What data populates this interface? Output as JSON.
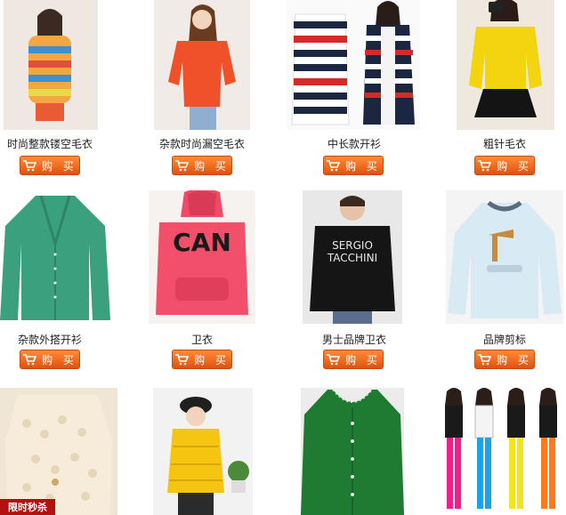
{
  "buy_label": "购 买",
  "products": [
    {
      "title": "时尚整款镂空毛衣",
      "photo": "striped-colorful-sweater"
    },
    {
      "title": "杂款时尚漏空毛衣",
      "photo": "orange-knit-sweater"
    },
    {
      "title": "中长款开衫",
      "photo": "navy-red-striped-cardigan"
    },
    {
      "title": "粗针毛衣",
      "photo": "yellow-cable-knit-sweater"
    },
    {
      "title": "杂款外搭开衫",
      "photo": "green-cardigan"
    },
    {
      "title": "卫衣",
      "photo": "pink-can-hoodie",
      "print": "CAN"
    },
    {
      "title": "男士品牌卫衣",
      "photo": "black-sergio-tacchini-hoodie",
      "print_line1": "SERGIO",
      "print_line2": "TACCHINI"
    },
    {
      "title": "品牌剪标",
      "photo": "light-blue-sweatshirt"
    },
    {
      "title": "",
      "photo": "cream-lace-sweater",
      "badge": "限时秒杀"
    },
    {
      "title": "",
      "photo": "yellow-puffer-jacket"
    },
    {
      "title": "",
      "photo": "green-pearl-cardigan"
    },
    {
      "title": "",
      "photo": "colorful-leggings-group"
    }
  ],
  "colors": {
    "button": "#e8600f",
    "badge": "#b51010"
  }
}
